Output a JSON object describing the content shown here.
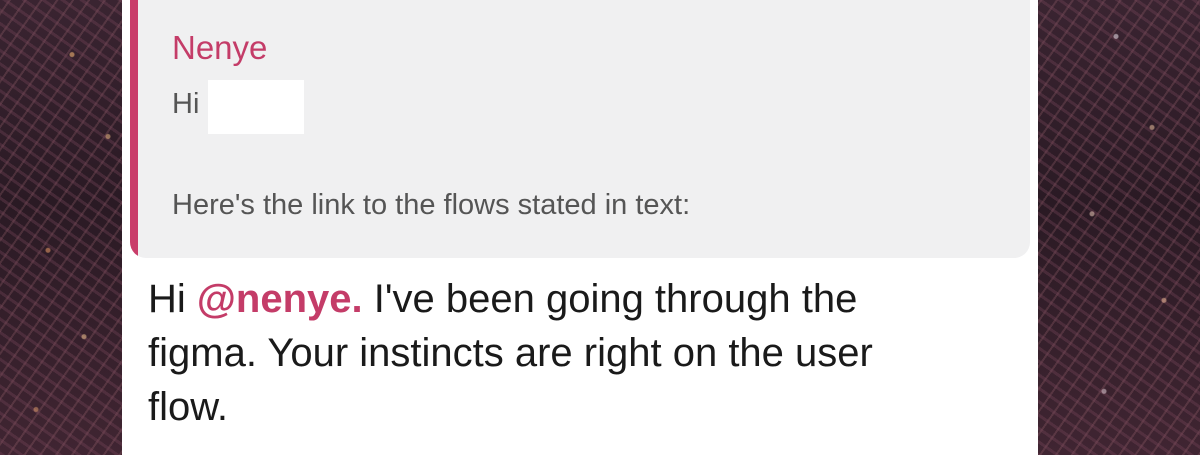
{
  "quote": {
    "author": "Nenye",
    "greeting": "Hi",
    "body": "Here's the link to the flows stated in text:"
  },
  "message": {
    "prefix": "Hi ",
    "mention": "@nenye.",
    "text_line1_rest": " I've been going through the",
    "text_line2": "figma. Your instincts are right on the user",
    "text_line3": "flow."
  },
  "colors": {
    "accent": "#c43c68",
    "quote_background": "#f0f0f1",
    "message_text": "#1a1a1a",
    "quote_text": "#555555"
  }
}
